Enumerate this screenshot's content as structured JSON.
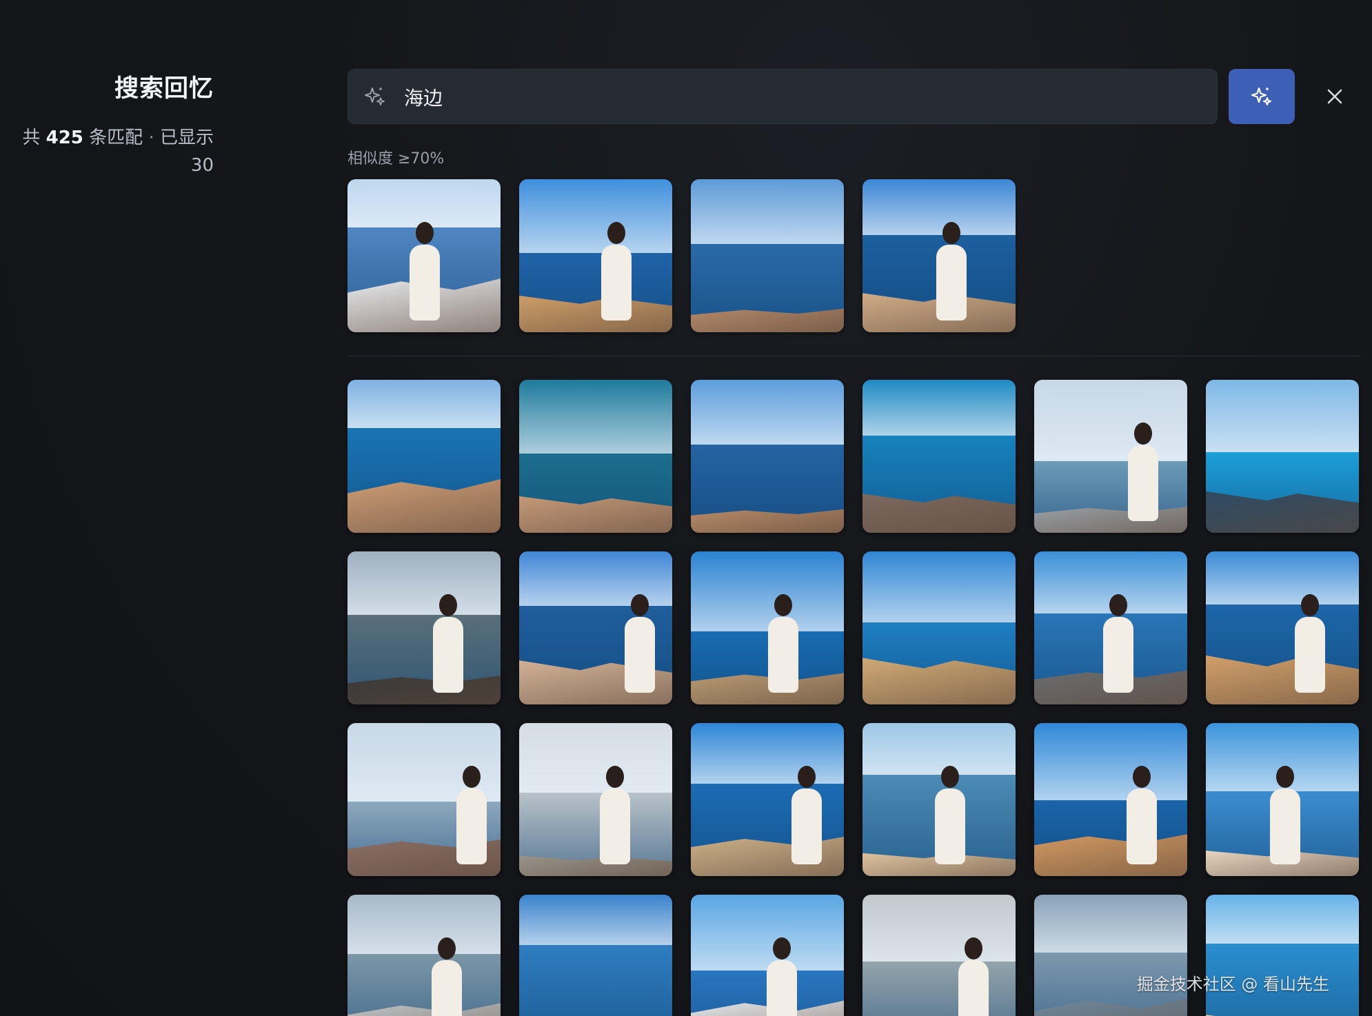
{
  "sidebar": {
    "title": "搜索回忆",
    "stats_prefix": "共",
    "match_count": "425",
    "stats_middle": "条匹配",
    "stats_separator": " · ",
    "shown_label": "已显示",
    "shown_count": "30"
  },
  "search": {
    "icon": "sparkle-icon",
    "query": "海边",
    "ai_button_icon": "sparkle-icon",
    "close_icon": "close-icon"
  },
  "similar_section": {
    "label": "相似度 ≥70%"
  },
  "top_results": [
    {
      "scene": "balcony-railing-sea",
      "sky": "#bfd7ee",
      "sea": "#4f86c2",
      "land": "#e9ecef",
      "person": true
    },
    {
      "scene": "woman-umbrella-rocks",
      "sky": "#3f8fdc",
      "sea": "#1f63a8",
      "land": "#d1a06a",
      "person": true
    },
    {
      "scene": "rocky-coast",
      "sky": "#5d9ad8",
      "sea": "#2a6aa8",
      "land": "#b3896a",
      "person": false
    },
    {
      "scene": "umbrella-selfie-sea",
      "sky": "#3c86d6",
      "sea": "#1c5f9f",
      "land": "#d4b08a",
      "person": true
    }
  ],
  "results": [
    {
      "scene": "rocks-and-hut",
      "sky": "#7fb2e3",
      "sea": "#1a74b4",
      "land": "#cf9e76",
      "person": false
    },
    {
      "scene": "white-hut-on-rocks",
      "sky": "#1e7a9c",
      "sea": "#1c6e8e",
      "land": "#c89c7a",
      "person": false
    },
    {
      "scene": "coast-clouds",
      "sky": "#5c9ddc",
      "sea": "#2463a2",
      "land": "#b68a68",
      "person": false
    },
    {
      "scene": "blue-water-rocks",
      "sky": "#1f8ac4",
      "sea": "#1782bd",
      "land": "#7d6a60",
      "person": false
    },
    {
      "scene": "woman-pier-sign",
      "sky": "#c7d7e6",
      "sea": "#6c9ab8",
      "land": "#9aa0a6",
      "person": true
    },
    {
      "scene": "turquoise-harbor",
      "sky": "#7fb8e6",
      "sea": "#1c9fd8",
      "land": "#2d4c66",
      "person": false
    },
    {
      "scene": "woman-railing-grey-sea",
      "sky": "#9fb0bf",
      "sea": "#59707a",
      "land": "#3a3a3a",
      "person": true
    },
    {
      "scene": "woman-arms-open",
      "sky": "#3f86d6",
      "sea": "#1f5e9c",
      "land": "#d7b69a",
      "person": true
    },
    {
      "scene": "umbrella-on-cliff",
      "sky": "#2b82d2",
      "sea": "#186cb2",
      "land": "#b99a72",
      "person": true
    },
    {
      "scene": "lighthouse-red",
      "sky": "#2f86d4",
      "sea": "#1e7fc2",
      "land": "#d4ad78",
      "person": false
    },
    {
      "scene": "pink-van",
      "sky": "#3a8fd8",
      "sea": "#2a76b8",
      "land": "#6b6d70",
      "person": true
    },
    {
      "scene": "umbrella-sitting",
      "sky": "#3a8ad6",
      "sea": "#1d66a8",
      "land": "#d7a46c",
      "person": true
    },
    {
      "scene": "woman-red-top-railing",
      "sky": "#c8d8e6",
      "sea": "#8ea8be",
      "land": "#8a6f64",
      "person": true
    },
    {
      "scene": "woman-stone-railing",
      "sky": "#d6dde4",
      "sea": "#b8c2c8",
      "land": "#9a958c",
      "person": true
    },
    {
      "scene": "umbrella-walk-sea",
      "sky": "#2e86d6",
      "sea": "#1c6cb4",
      "land": "#cfb28a",
      "person": true
    },
    {
      "scene": "beach-waves",
      "sky": "#9cc7e6",
      "sea": "#4c8cb6",
      "land": "#e0c6a2",
      "person": true
    },
    {
      "scene": "umbrella-rock-seat",
      "sky": "#2f88d8",
      "sea": "#1a64a8",
      "land": "#d49a62",
      "person": true
    },
    {
      "scene": "umbrella-sign-wall",
      "sky": "#3b94dc",
      "sea": "#3b8dd0",
      "land": "#ead9c4",
      "person": true
    },
    {
      "scene": "woman-grey-sea",
      "sky": "#a7b9c8",
      "sea": "#7b97a8",
      "land": "#c0c6c9",
      "person": true
    },
    {
      "scene": "lighthouse-wall",
      "sky": "#3a82cc",
      "sea": "#2e7dc0",
      "land": "#b8a892",
      "person": false
    },
    {
      "scene": "woman-balcony",
      "sky": "#5aa6e4",
      "sea": "#2a76c0",
      "land": "#e6eaee",
      "person": true
    },
    {
      "scene": "beach-buildings",
      "sky": "#c2c8cc",
      "sea": "#93a4ac",
      "land": "#d8cdbd",
      "person": true
    },
    {
      "scene": "misty-sea",
      "sky": "#8aa2b8",
      "sea": "#7c98ae",
      "land": "#6f8aa0",
      "person": false
    },
    {
      "scene": "framed-sea-boat",
      "sky": "#66b2e8",
      "sea": "#2b8fd0",
      "land": "#e4d2b6",
      "person": false
    }
  ],
  "watermark": "掘金技术社区 @ 看山先生"
}
